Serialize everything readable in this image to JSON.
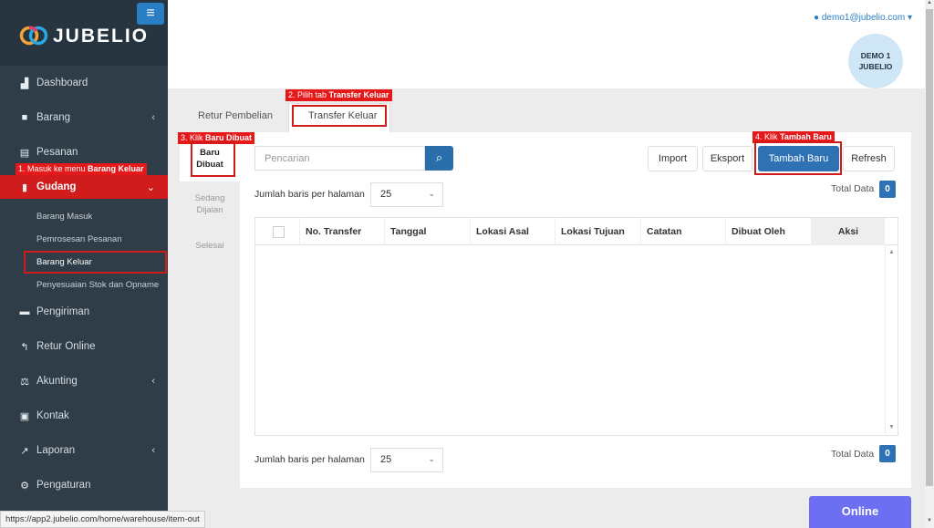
{
  "brand": {
    "name": "JUBELIO",
    "menu_toggle_icon": "hamburger-icon"
  },
  "sidebar": {
    "items": [
      {
        "label": "Dashboard",
        "icon": "chart-icon"
      },
      {
        "label": "Barang",
        "icon": "cubes-icon",
        "chevron": "‹"
      },
      {
        "label": "Pesanan",
        "icon": "cart-icon"
      },
      {
        "label": "Gudang",
        "icon": "building-icon",
        "chevron": "⌄"
      },
      {
        "label": "Pengiriman",
        "icon": "truck-icon"
      },
      {
        "label": "Retur Online",
        "icon": "reply-icon"
      },
      {
        "label": "Akunting",
        "icon": "scale-icon",
        "chevron": "‹"
      },
      {
        "label": "Kontak",
        "icon": "contact-card-icon"
      },
      {
        "label": "Laporan",
        "icon": "line-chart-icon",
        "chevron": "‹"
      },
      {
        "label": "Pengaturan",
        "icon": "cogs-icon"
      }
    ],
    "sub_items": [
      "Barang Masuk",
      "Pemrosesan Pesanan",
      "Barang Keluar",
      "Penyesuaian Stok dan Opname"
    ]
  },
  "annotations": {
    "step1_prefix": "1. Masuk ke menu ",
    "step1_bold": "Barang Keluar",
    "step2_prefix": "2. Pilih tab ",
    "step2_bold": "Transfer Keluar",
    "step3_prefix": "3. Klik ",
    "step3_bold": "Baru Dibuat",
    "step4_prefix": "4. Klik ",
    "step4_bold": "Tambah Baru"
  },
  "header": {
    "user_email": "demo1@jubelio.com",
    "avatar_line1": "DEMO 1",
    "avatar_line2": "JUBELIO"
  },
  "tabs": [
    "Retur Pembelian",
    "Transfer Keluar"
  ],
  "status_tabs": [
    {
      "line1": "Baru",
      "line2": "Dibuat"
    },
    {
      "line1": "Sedang",
      "line2": "Dijalan"
    },
    {
      "line1": "Selesai",
      "line2": ""
    }
  ],
  "toolbar": {
    "search_placeholder": "Pencarian",
    "import_label": "Import",
    "export_label": "Eksport",
    "add_label": "Tambah Baru",
    "refresh_label": "Refresh"
  },
  "pagination": {
    "rows_label": "Jumlah baris per halaman",
    "rows_value": "25",
    "total_label": "Total Data",
    "total_value": "0"
  },
  "table": {
    "columns": [
      "No. Transfer",
      "Tanggal",
      "Lokasi Asal",
      "Lokasi Tujuan",
      "Catatan",
      "Dibuat Oleh",
      "Aksi"
    ],
    "rows": []
  },
  "chat": {
    "label": "Online"
  },
  "status_url": "https://app2.jubelio.com/home/warehouse/item-out",
  "colors": {
    "sidebar": "#2f3d48",
    "accent": "#2f72b3",
    "highlight": "#d01c1c",
    "chat": "#6d6ff2"
  }
}
